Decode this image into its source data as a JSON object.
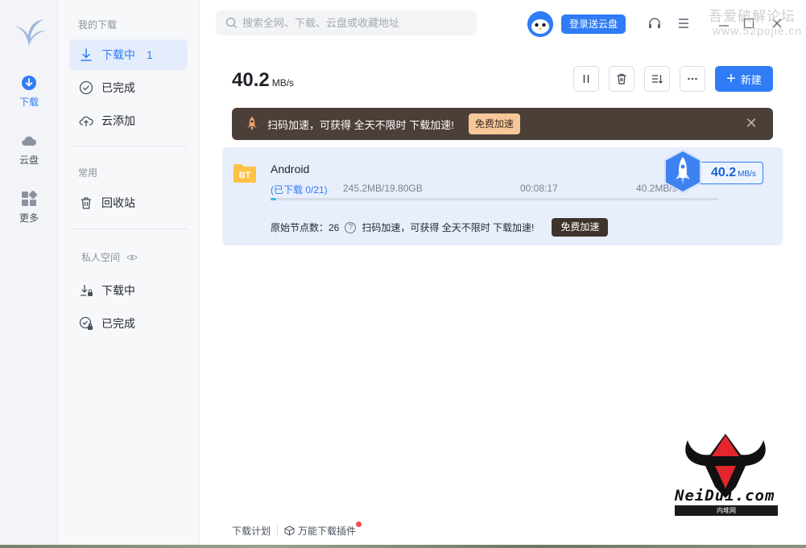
{
  "rail": {
    "items": [
      {
        "label": "下载",
        "icon": "download-circle-icon"
      },
      {
        "label": "云盘",
        "icon": "cloud-icon"
      },
      {
        "label": "更多",
        "icon": "grid-icon"
      }
    ]
  },
  "sidebar": {
    "my_downloads_header": "我的下载",
    "downloading_label": "下载中",
    "downloading_count": "1",
    "completed_label": "已完成",
    "cloud_add_label": "云添加",
    "common_header": "常用",
    "recycle_label": "回收站",
    "private_header": "私人空间",
    "private_downloading_label": "下载中",
    "private_completed_label": "已完成"
  },
  "topbar": {
    "search_placeholder": "搜索全网、下载、云盘或收藏地址",
    "login_label": "登录送云盘",
    "watermark_line1": "吾爱破解论坛",
    "watermark_line2": "www.52pojie.cn"
  },
  "main": {
    "speed_value": "40.2",
    "speed_unit": "MB/s",
    "new_label": "新建",
    "banner_text": "扫码加速，可获得 全天不限时 下载加速!",
    "banner_button": "免费加速",
    "banner_close": "✕"
  },
  "task": {
    "name": "Android",
    "icon_text": "BT",
    "status": "(已下载 0/21)",
    "size": "245.2MB/19.80GB",
    "time": "00:08:17",
    "rate": "40.2MB/s",
    "progress": 0.012,
    "nodes_text": "原始节点数：26",
    "help_glyph": "?",
    "info_text": "扫码加速，可获得 全天不限时 下载加速!",
    "free_button": "免费加速",
    "boost_value": "40.2",
    "boost_unit": "MB/s"
  },
  "footer": {
    "plan_label": "下载计划",
    "plugin_label": "万能下载插件"
  },
  "brand": {
    "name": "NeiDui.com",
    "sub": "内堆网"
  },
  "colors": {
    "accent": "#2f7cf6",
    "banner_bg": "#4b3f38",
    "progress": "#2ec1e0"
  }
}
